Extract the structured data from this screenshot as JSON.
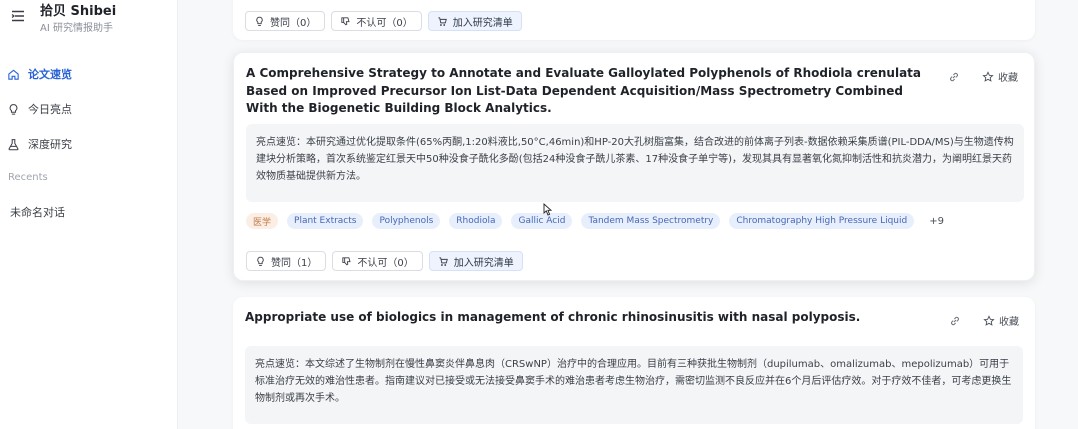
{
  "app": {
    "title": "拾贝 Shibei",
    "subtitle": "AI 研究情报助手"
  },
  "nav": [
    {
      "label": "论文速览",
      "icon": "home-icon",
      "active": true
    },
    {
      "label": "今日亮点",
      "icon": "bulb-icon",
      "active": false
    },
    {
      "label": "深度研究",
      "icon": "flask-icon",
      "active": false
    }
  ],
  "recents": {
    "label": "Recents",
    "items": [
      "未命名对话"
    ]
  },
  "colors": {
    "accent": "#2a63d6",
    "tag_bg": "#e8effc",
    "category_tag_bg": "#fbeee4"
  },
  "cards": [
    {
      "actions": {
        "like": "赞同（0）",
        "dislike": "不认可（0）",
        "add": "加入研究清单"
      }
    },
    {
      "title": "A Comprehensive Strategy to Annotate and Evaluate Galloylated Polyphenols of Rhodiola crenulata Based on Improved Precursor Ion List-Data Dependent Acquisition/Mass Spectrometry Combined With the Biogenetic Building Block Analytics.",
      "favorite": "收藏",
      "summary": "亮点速览：本研究通过优化提取条件(65%丙酮,1:20料液比,50°C,46min)和HP-20大孔树脂富集，结合改进的前体离子列表-数据依赖采集质谱(PIL-DDA/MS)与生物遗传构建块分析策略，首次系统鉴定红景天中50种没食子酰化多酚(包括24种没食子酰儿茶素、17种没食子单宁等)，发现其具有显著氧化氮抑制活性和抗炎潜力，为阐明红景天药效物质基础提供新方法。",
      "tags": [
        "医学",
        "Plant Extracts",
        "Polyphenols",
        "Rhodiola",
        "Gallic Acid",
        "Tandem Mass Spectrometry",
        "Chromatography High Pressure Liquid"
      ],
      "tags_more": "+9",
      "actions": {
        "like": "赞同（1）",
        "dislike": "不认可（0）",
        "add": "加入研究清单"
      }
    },
    {
      "title": "Appropriate use of biologics in management of chronic rhinosinusitis with nasal polyposis.",
      "favorite": "收藏",
      "summary": "亮点速览：本文综述了生物制剂在慢性鼻窦炎伴鼻息肉（CRSwNP）治疗中的合理应用。目前有三种获批生物制剂（dupilumab、omalizumab、mepolizumab）可用于标准治疗无效的难治性患者。指南建议对已接受或无法接受鼻窦手术的难治患者考虑生物治疗，需密切监测不良反应并在6个月后评估疗效。对于疗效不佳者，可考虑更换生物制剂或再次手术。"
    }
  ]
}
